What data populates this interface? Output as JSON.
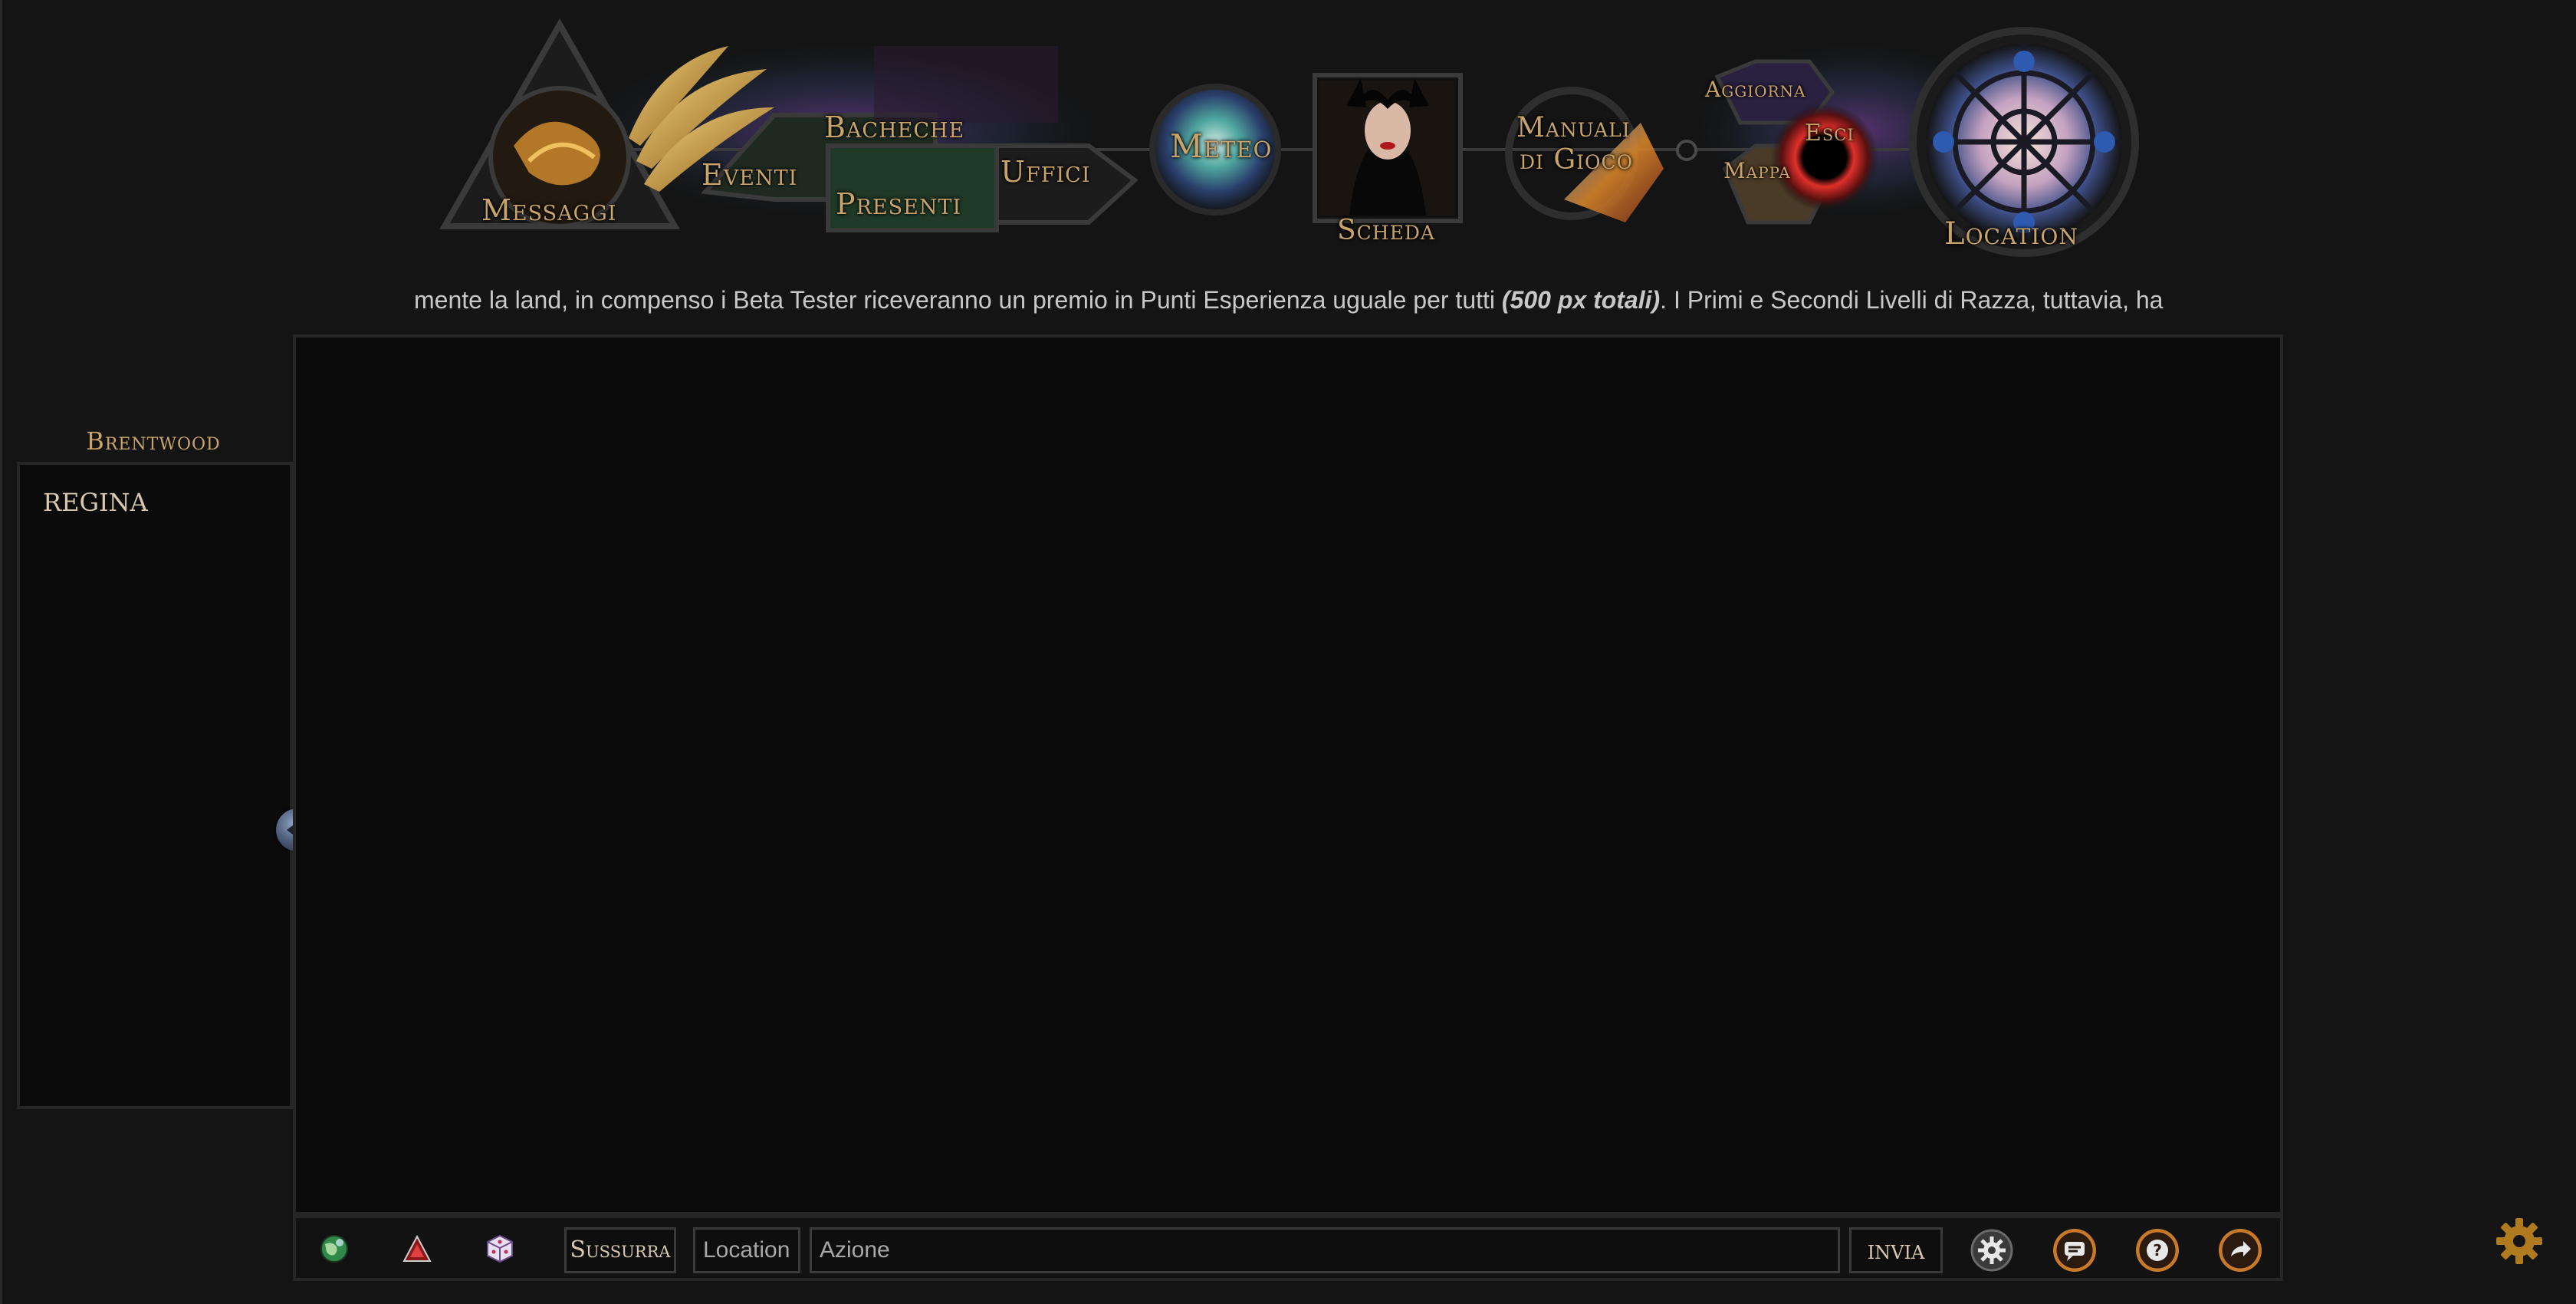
{
  "nav": {
    "messaggi": "Messaggi",
    "eventi": "Eventi",
    "bacheche": "Bacheche",
    "presenti": "Presenti",
    "uffici": "Uffici",
    "meteo": "Meteo",
    "scheda": "Scheda",
    "manuali_line1": "Manuali",
    "manuali_line2": "di Gioco",
    "aggiorna": "Aggiorna",
    "esci": "Esci",
    "mappa": "Mappa",
    "location": "Location"
  },
  "ticker": {
    "text_before": "mente la land, in compenso i Beta Tester riceveranno un premio in Punti Esperienza uguale per tutti ",
    "text_bold": "(500 px totali)",
    "text_after": ". I Primi e Secondi Livelli di Razza, tuttavia, ha"
  },
  "sidebar": {
    "title": "Brentwood",
    "items": [
      {
        "label": "REGINA"
      }
    ]
  },
  "bottom_bar": {
    "icons": [
      "globe-icon",
      "triangle-icon",
      "dice-icon"
    ],
    "sussurra_label": "Sussurra",
    "location_placeholder": "Location",
    "azione_placeholder": "Azione",
    "invia_label": "invia",
    "right_icons": [
      "settings-icon",
      "chat-icon",
      "help-icon",
      "exit-icon"
    ]
  },
  "colors": {
    "gold": "#c9a46a",
    "background": "#141414",
    "panel": "#0b0b0b",
    "border": "#262626",
    "accent_orange": "#c87a2a"
  }
}
